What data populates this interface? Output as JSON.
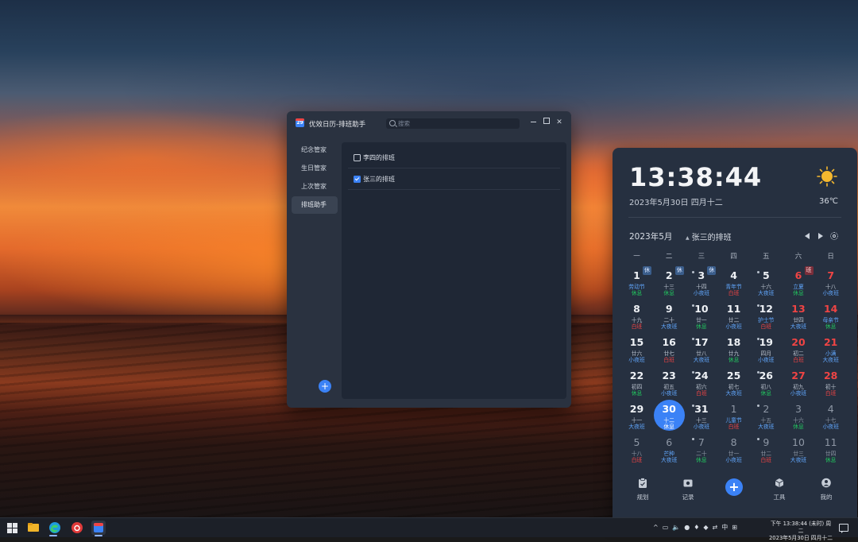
{
  "window": {
    "title": "优效日历-排班助手",
    "app_icon_text": "29",
    "search_placeholder": "搜索",
    "sidebar": [
      "纪念管家",
      "生日管家",
      "上次管家",
      "排班助手"
    ],
    "active_sidebar": 3,
    "schedules": [
      {
        "label": "李四的排班",
        "checked": false
      },
      {
        "label": "张三的排班",
        "checked": true
      }
    ],
    "add_label": "+"
  },
  "widget": {
    "time": "13:38:44",
    "date": "2023年5月30日 四月十二",
    "temperature": "36℃",
    "weather_icon": "sun-icon",
    "month": "2023年5月",
    "schedule": "张三的排班",
    "weekdays": [
      "一",
      "二",
      "三",
      "四",
      "五",
      "六",
      "日"
    ],
    "days": [
      {
        "n": "1",
        "l": "劳动节",
        "s": "休息",
        "st": "rest",
        "badge": "休",
        "bt": "rest",
        "lc": "blue"
      },
      {
        "n": "2",
        "l": "十三",
        "s": "休息",
        "st": "rest",
        "badge": "休",
        "bt": "rest"
      },
      {
        "n": "3",
        "l": "十四",
        "s": "小夜班",
        "st": "small",
        "badge": "休",
        "bt": "rest",
        "dot": true
      },
      {
        "n": "4",
        "l": "青年节",
        "s": "白班",
        "st": "day",
        "lc": "blue"
      },
      {
        "n": "5",
        "l": "十六",
        "s": "大夜班",
        "st": "big",
        "dot": true
      },
      {
        "n": "6",
        "l": "立夏",
        "s": "休息",
        "st": "rest",
        "badge": "班",
        "bt": "work",
        "lc": "blue",
        "weekend": true
      },
      {
        "n": "7",
        "l": "十八",
        "s": "小夜班",
        "st": "small",
        "weekend": true
      },
      {
        "n": "8",
        "l": "十九",
        "s": "白班",
        "st": "day"
      },
      {
        "n": "9",
        "l": "二十",
        "s": "大夜班",
        "st": "big"
      },
      {
        "n": "10",
        "l": "廿一",
        "s": "休息",
        "st": "rest",
        "dot": true
      },
      {
        "n": "11",
        "l": "廿二",
        "s": "小夜班",
        "st": "small"
      },
      {
        "n": "12",
        "l": "护士节",
        "s": "白班",
        "st": "day",
        "lc": "blue",
        "dot": true
      },
      {
        "n": "13",
        "l": "廿四",
        "s": "大夜班",
        "st": "big",
        "weekend": true
      },
      {
        "n": "14",
        "l": "母亲节",
        "s": "休息",
        "st": "rest",
        "lc": "blue",
        "weekend": true
      },
      {
        "n": "15",
        "l": "廿六",
        "s": "小夜班",
        "st": "small"
      },
      {
        "n": "16",
        "l": "廿七",
        "s": "白班",
        "st": "day"
      },
      {
        "n": "17",
        "l": "廿八",
        "s": "大夜班",
        "st": "big",
        "dot": true
      },
      {
        "n": "18",
        "l": "廿九",
        "s": "休息",
        "st": "rest"
      },
      {
        "n": "19",
        "l": "四月",
        "s": "小夜班",
        "st": "small",
        "dot": true
      },
      {
        "n": "20",
        "l": "初二",
        "s": "白班",
        "st": "day",
        "weekend": true
      },
      {
        "n": "21",
        "l": "小满",
        "s": "大夜班",
        "st": "big",
        "lc": "blue",
        "weekend": true
      },
      {
        "n": "22",
        "l": "初四",
        "s": "休息",
        "st": "rest"
      },
      {
        "n": "23",
        "l": "初五",
        "s": "小夜班",
        "st": "small"
      },
      {
        "n": "24",
        "l": "初六",
        "s": "白班",
        "st": "day",
        "dot": true
      },
      {
        "n": "25",
        "l": "初七",
        "s": "大夜班",
        "st": "big"
      },
      {
        "n": "26",
        "l": "初八",
        "s": "休息",
        "st": "rest",
        "dot": true
      },
      {
        "n": "27",
        "l": "初九",
        "s": "小夜班",
        "st": "small",
        "weekend": true
      },
      {
        "n": "28",
        "l": "初十",
        "s": "白班",
        "st": "day",
        "weekend": true
      },
      {
        "n": "29",
        "l": "十一",
        "s": "大夜班",
        "st": "big"
      },
      {
        "n": "30",
        "l": "十二",
        "s": "休息",
        "st": "rest",
        "today": true
      },
      {
        "n": "31",
        "l": "十三",
        "s": "小夜班",
        "st": "small",
        "dot": true
      },
      {
        "n": "1",
        "l": "儿童节",
        "s": "白班",
        "st": "day",
        "lc": "blue",
        "other": true
      },
      {
        "n": "2",
        "l": "十五",
        "s": "大夜班",
        "st": "big",
        "other": true,
        "dot": true
      },
      {
        "n": "3",
        "l": "十六",
        "s": "休息",
        "st": "rest",
        "other": true
      },
      {
        "n": "4",
        "l": "十七",
        "s": "小夜班",
        "st": "small",
        "other": true
      },
      {
        "n": "5",
        "l": "十八",
        "s": "白班",
        "st": "day",
        "other": true
      },
      {
        "n": "6",
        "l": "芒种",
        "s": "大夜班",
        "st": "big",
        "lc": "blue",
        "other": true
      },
      {
        "n": "7",
        "l": "二十",
        "s": "休息",
        "st": "rest",
        "other": true,
        "dot": true
      },
      {
        "n": "8",
        "l": "廿一",
        "s": "小夜班",
        "st": "small",
        "other": true
      },
      {
        "n": "9",
        "l": "廿二",
        "s": "白班",
        "st": "day",
        "other": true,
        "dot": true
      },
      {
        "n": "10",
        "l": "廿三",
        "s": "大夜班",
        "st": "big",
        "other": true
      },
      {
        "n": "11",
        "l": "廿四",
        "s": "休息",
        "st": "rest",
        "other": true
      }
    ],
    "shift_colors": {
      "rest": "#22c55e",
      "small": "#60a5fa",
      "day": "#ef4444",
      "big": "#60a5fa"
    },
    "lunar_blue": "#60a5fa",
    "bottom_nav": [
      {
        "label": "规划",
        "icon": "clipboard-icon"
      },
      {
        "label": "记录",
        "icon": "camera-icon"
      },
      {
        "label": "工具",
        "icon": "cube-icon"
      },
      {
        "label": "我的",
        "icon": "user-icon"
      }
    ],
    "add_label": "+"
  },
  "taskbar": {
    "tray": [
      "^",
      "▭",
      "🔈",
      "●",
      "♦",
      "◆",
      "⇄",
      "中",
      "⊞"
    ],
    "clock_line1": "下午 13:38:44 (未时) 周二",
    "clock_line2": "2023年5月30日 四月十二"
  }
}
